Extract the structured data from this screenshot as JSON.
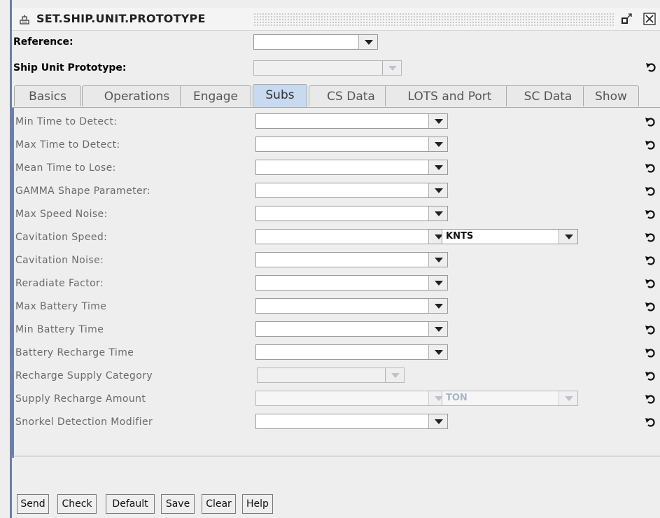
{
  "window": {
    "title": "SET.SHIP.UNIT.PROTOTYPE"
  },
  "header": {
    "reference_label": "Reference:",
    "reference_value": "",
    "prototype_label": "Ship Unit Prototype:",
    "prototype_value": ""
  },
  "tabs": [
    {
      "label": "Basics",
      "active": false
    },
    {
      "label": "Operations",
      "active": false
    },
    {
      "label": "Engage",
      "active": false
    },
    {
      "label": "Subs",
      "active": true
    },
    {
      "label": "CS Data",
      "active": false
    },
    {
      "label": "LOTS and Port",
      "active": false
    },
    {
      "label": "SC Data",
      "active": false
    },
    {
      "label": "Show",
      "active": false
    }
  ],
  "fields": [
    {
      "label": "Min Time to Detect:",
      "value": "",
      "enabled": true
    },
    {
      "label": "Max Time to Detect:",
      "value": "",
      "enabled": true
    },
    {
      "label": "Mean Time to Lose:",
      "value": "",
      "enabled": true
    },
    {
      "label": "GAMMA Shape Parameter:",
      "value": "",
      "enabled": true
    },
    {
      "label": "Max Speed Noise:",
      "value": "",
      "enabled": true
    },
    {
      "label": "Cavitation Speed:",
      "value": "",
      "enabled": true,
      "unit": "KNTS"
    },
    {
      "label": "Cavitation Noise:",
      "value": "",
      "enabled": true
    },
    {
      "label": "Reradiate Factor:",
      "value": "",
      "enabled": true
    },
    {
      "label": "Max Battery Time",
      "value": "",
      "enabled": true
    },
    {
      "label": "Min Battery Time",
      "value": "",
      "enabled": true
    },
    {
      "label": "Battery Recharge Time",
      "value": "",
      "enabled": true
    },
    {
      "label": "Recharge Supply Category",
      "value": "",
      "enabled": false
    },
    {
      "label": "Supply Recharge Amount",
      "value": "",
      "enabled": false,
      "unit": "TON"
    },
    {
      "label": "Snorkel Detection Modifier",
      "value": "",
      "enabled": true
    }
  ],
  "buttons": {
    "send": "Send",
    "check": "Check",
    "default": "Default",
    "save": "Save",
    "clear": "Clear",
    "help": "Help"
  },
  "icons": {
    "title_icon": "app-icon",
    "restore": "restore-icon",
    "close": "close-icon",
    "undo": "undo-icon"
  }
}
